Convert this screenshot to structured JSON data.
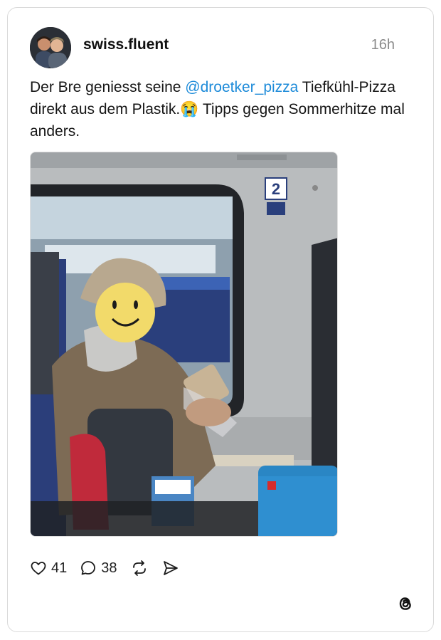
{
  "post": {
    "username": "swiss.fluent",
    "time": "16h",
    "text_before": "Der Bre geniesst seine ",
    "mention": "@droetker_pizza",
    "text_after": " Tiefkühl-Pizza direkt aus dem Plastik.",
    "emoji": "😭",
    "text_end": " Tipps gegen Sommerhitze mal anders."
  },
  "actions": {
    "likes": "41",
    "replies": "38"
  },
  "icons": {
    "like": "heart-icon",
    "reply": "comment-icon",
    "repost": "repost-icon",
    "share": "send-icon",
    "brand": "threads-logo-icon"
  },
  "colors": {
    "mention": "#1d8bd9",
    "time": "#8a8a8a",
    "text": "#161616"
  }
}
